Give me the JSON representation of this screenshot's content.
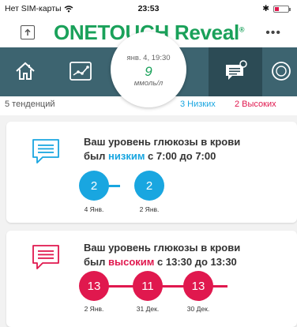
{
  "status_bar": {
    "carrier": "Нет SIM-карты",
    "time": "23:53",
    "bluetooth_glyph": "✱"
  },
  "header": {
    "logo_part1": "ONE",
    "logo_part2": "TOUCH",
    "logo_part3": "Reveal",
    "logo_reg": "®",
    "more_label": "•••"
  },
  "last_reading": {
    "date": "янв. 4, 19:30",
    "value": "9",
    "unit": "ммоль/л"
  },
  "summary": {
    "count": "5 тенденций",
    "low": "3 Низких",
    "high": "2 Высоких"
  },
  "patterns": [
    {
      "type": "low",
      "line1": "Ваш уровень глюкозы в крови",
      "line2_prefix": "был ",
      "line2_emph": "низким",
      "line2_suffix": " с 7:00 до 7:00",
      "readings": [
        {
          "value": "2",
          "date": "4 Янв."
        },
        {
          "value": "2",
          "date": "2 Янв."
        }
      ]
    },
    {
      "type": "high",
      "line1": "Ваш уровень глюкозы в крови",
      "line2_prefix": "был ",
      "line2_emph": "высоким",
      "line2_suffix": " с 13:30 до 13:30",
      "readings": [
        {
          "value": "13",
          "date": "2 Янв."
        },
        {
          "value": "11",
          "date": "31 Дек."
        },
        {
          "value": "13",
          "date": "30 Дек."
        }
      ]
    }
  ],
  "colors": {
    "brand_green": "#1aa15a",
    "nav_bg": "#3d6470",
    "low": "#19a6e0",
    "high": "#e0184e"
  },
  "icons": {
    "home": "home-icon",
    "logbook": "trend-chart-icon",
    "patterns": "message-icon",
    "more": "circle-icon"
  }
}
